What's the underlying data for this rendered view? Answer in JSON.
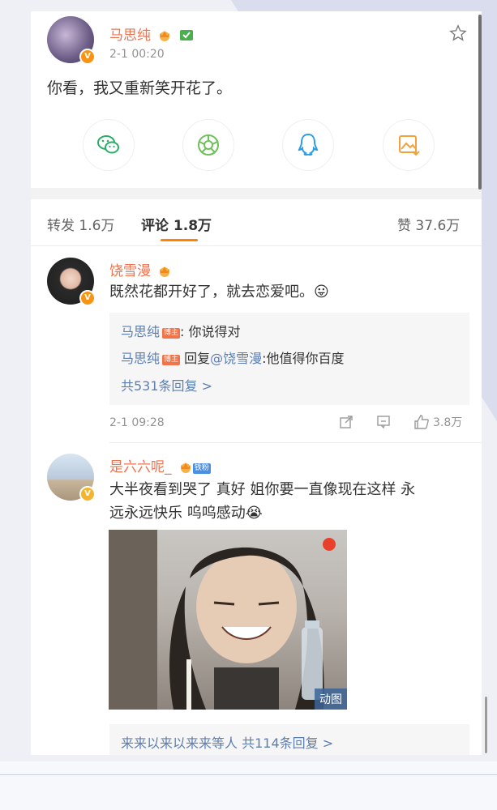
{
  "post": {
    "author": "马思纯",
    "time": "2-1 00:20",
    "text": "你看，我又重新笑开花了。",
    "share_icons": [
      "wechat-icon",
      "moments-icon",
      "qq-icon",
      "save-image-icon"
    ]
  },
  "tabs": {
    "repost": "转发 1.6万",
    "comments": "评论 1.8万",
    "likes": "赞 37.6万"
  },
  "comments": [
    {
      "author": "饶雪漫",
      "text": "既然花都开好了，就去恋爱吧。",
      "emoji": "😛",
      "replies": [
        {
          "user": "马思纯",
          "tag": "博主",
          "text": ": 你说得对"
        },
        {
          "user": "马思纯",
          "tag": "博主",
          "reply_word": "回复",
          "mention": "@饶雪漫",
          "text": ":他值得你百度"
        }
      ],
      "more_replies": "共531条回复 >",
      "time": "2-1 09:28",
      "likes": "3.8万"
    },
    {
      "author": "是六六呢_",
      "fan_tag": "铁粉",
      "text_line1": "大半夜看到哭了 真好 姐你要一直像现在这样 永",
      "text_line2": "远永远快乐 呜呜感动",
      "emoji": "😭",
      "image_label": "动图",
      "reply_summary_names": "来来以来以来来等人",
      "reply_summary_count": "共114条回复 >"
    }
  ],
  "colors": {
    "name": "#eb7350",
    "link": "#5d7eb0",
    "accent": "#ff8200",
    "vip_badge": "#f79414"
  }
}
